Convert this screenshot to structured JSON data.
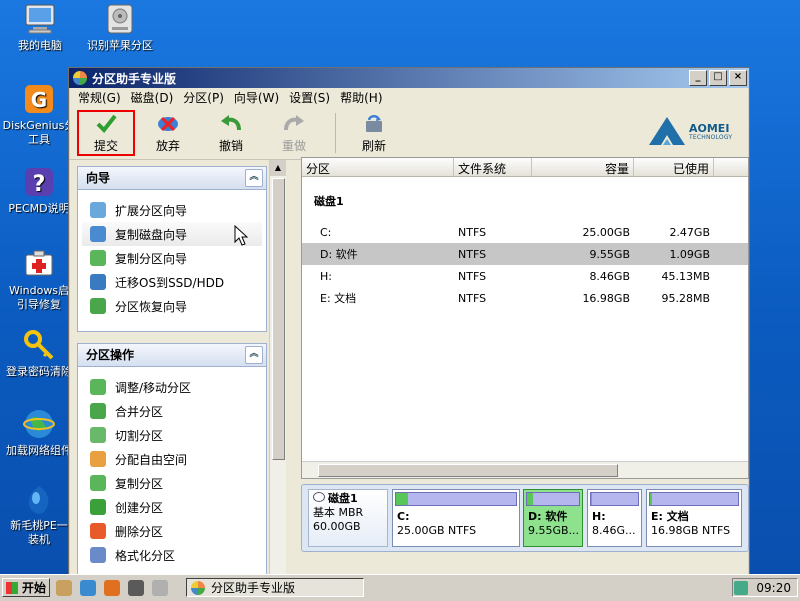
{
  "desktop": {
    "icons": [
      {
        "label": "我的电脑",
        "icon": "computer-icon"
      },
      {
        "label": "识别苹果分区",
        "icon": "disk-icon"
      },
      {
        "label": "DiskGenius分区工具",
        "line1": "DiskGenius分",
        "line2": "工具",
        "icon": "diskgenius-icon"
      },
      {
        "label": "PECMD说明",
        "icon": "help-icon"
      },
      {
        "label": "Windows启动引导修复",
        "line1": "Windows启",
        "line2": "引导修复",
        "icon": "repair-icon"
      },
      {
        "label": "登录密码清除",
        "line1": "登录密码清除",
        "icon": "key-icon"
      },
      {
        "label": "加载网络组件",
        "line1": "加载网络组件",
        "icon": "network-icon"
      },
      {
        "label": "新毛桃PE一键装机",
        "line1": "新毛桃PE一",
        "line2": "装机",
        "icon": "install-icon"
      }
    ]
  },
  "window": {
    "title": "分区助手专业版",
    "controls": {
      "minimize": "_",
      "maximize": "□",
      "close": "×"
    },
    "menu": [
      "常规(G)",
      "磁盘(D)",
      "分区(P)",
      "向导(W)",
      "设置(S)",
      "帮助(H)"
    ],
    "toolbar": {
      "submit": "提交",
      "discard": "放弃",
      "undo": "撤销",
      "redo": "重做",
      "refresh": "刷新"
    },
    "brand": {
      "name": "AOMEI",
      "sub": "TECHNOLOGY"
    }
  },
  "wizard_panel": {
    "title": "向导",
    "items": [
      "扩展分区向导",
      "复制磁盘向导",
      "复制分区向导",
      "迁移OS到SSD/HDD",
      "分区恢复向导"
    ]
  },
  "partition_ops_panel": {
    "title": "分区操作",
    "items": [
      "调整/移动分区",
      "合并分区",
      "切割分区",
      "分配自由空间",
      "复制分区",
      "创建分区",
      "删除分区",
      "格式化分区"
    ]
  },
  "partition_list": {
    "columns": [
      "分区",
      "文件系统",
      "容量",
      "已使用"
    ],
    "disk_label": "磁盘1",
    "rows": [
      {
        "name": "C:",
        "fs": "NTFS",
        "capacity": "25.00GB",
        "used": "2.47GB"
      },
      {
        "name": "D: 软件",
        "fs": "NTFS",
        "capacity": "9.55GB",
        "used": "1.09GB"
      },
      {
        "name": "H:",
        "fs": "NTFS",
        "capacity": "8.46GB",
        "used": "45.13MB"
      },
      {
        "name": "E: 文档",
        "fs": "NTFS",
        "capacity": "16.98GB",
        "used": "95.28MB"
      }
    ],
    "selected_row": 1
  },
  "disk_map": {
    "disk_name": "磁盘1",
    "disk_type": "基本 MBR",
    "disk_size": "60.00GB",
    "partitions": [
      {
        "name": "C:",
        "detail": "25.00GB NTFS",
        "used_fraction": 0.1
      },
      {
        "name": "D: 软件",
        "detail": "9.55GB...",
        "used_fraction": 0.11
      },
      {
        "name": "H:",
        "detail": "8.46G...",
        "used_fraction": 0.01
      },
      {
        "name": "E: 文档",
        "detail": "16.98GB NTFS",
        "used_fraction": 0.01
      }
    ]
  },
  "taskbar": {
    "start": "开始",
    "task_title": "分区助手专业版",
    "clock": "09:20"
  },
  "colors": {
    "desktop": "#0b5bc0",
    "titlebar": "#0a246a",
    "selected_partition": "#8ee28e",
    "highlight_box": "#e00000"
  }
}
